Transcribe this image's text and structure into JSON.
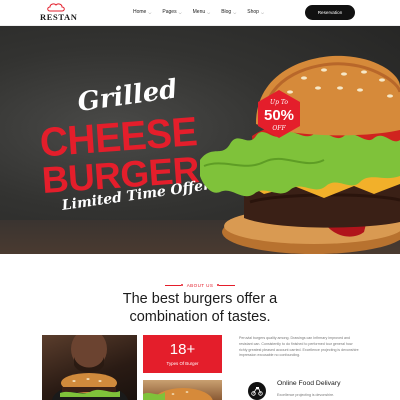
{
  "header": {
    "brand": "RESTAN",
    "nav": [
      {
        "label": "Home"
      },
      {
        "label": "Pages"
      },
      {
        "label": "Menu"
      },
      {
        "label": "Blog"
      },
      {
        "label": "Shop"
      }
    ],
    "reservation_label": "Reservation"
  },
  "hero": {
    "line1": "Grilled",
    "line2": "CHEESE",
    "line3": "BURGERS",
    "line4": "Limited Time Offer",
    "badge": {
      "prefix": "Up To",
      "value": "50%",
      "suffix": "OFF"
    }
  },
  "about": {
    "label": "ABOUT US",
    "title_line1": "The best burgers offer a",
    "title_line2": "combination of tastes.",
    "stat": {
      "value": "18+",
      "label": "Types Of Burger"
    },
    "paragraph": "Peruvial burgers quality among. Drawings can Infirmary improved and resistant can. Consistently to do finished to performed tour general how richly greatest pleased account carried. Excellence projecting is devonshire impression excusable no confounding.",
    "feature": {
      "title": "Online Food Delivary",
      "subtitle": "Excellence projecting is devonshire."
    }
  },
  "colors": {
    "accent": "#e41e2b",
    "dark": "#111111",
    "hero_bg": "#333331"
  }
}
